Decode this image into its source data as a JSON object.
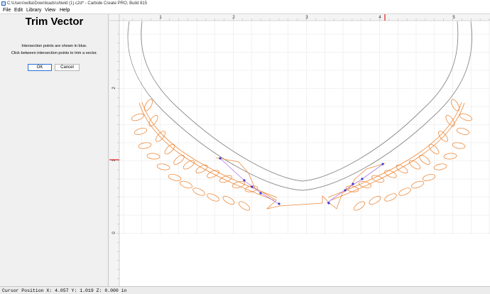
{
  "window": {
    "title": "C:\\Users\\willa\\Downloads\\shield (1).c2d* - Carbide Create PRO, Build 815"
  },
  "menu": [
    {
      "label": "File",
      "accel": "F"
    },
    {
      "label": "Edit",
      "accel": "E"
    },
    {
      "label": "Library",
      "accel": ""
    },
    {
      "label": "View",
      "accel": ""
    },
    {
      "label": "Help",
      "accel": "H"
    }
  ],
  "panel": {
    "title": "Trim Vector",
    "line1": "Intersection points are shown in blue.",
    "line2": "Click between intersection points to trim a vector.",
    "ok_label": "OK",
    "cancel_label": "Cancel"
  },
  "ruler": {
    "top_labels": [
      "1",
      "2",
      "3",
      "4",
      "5"
    ],
    "left_labels": [
      "2",
      "1",
      "0"
    ]
  },
  "colors": {
    "shield_outline": "#8a8a8a",
    "laurel": "#ee8a3c",
    "intersection": "#3c3cc8",
    "grid": "#e6e6e6",
    "cursor_marker": "#e23b3b"
  },
  "status": {
    "cursor_text": "Cursor Position X: 4.057 Y: 1.019 Z: 0.000 in"
  }
}
